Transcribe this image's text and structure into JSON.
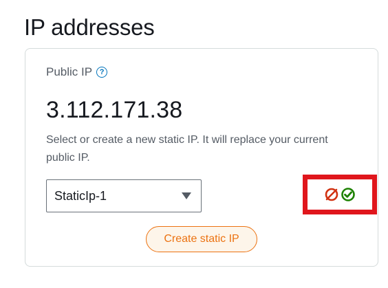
{
  "section": {
    "title": "IP addresses"
  },
  "card": {
    "label": "Public IP",
    "info_glyph": "?",
    "ip": "3.112.171.38",
    "description": "Select or create a new static IP. It will replace your current public IP.",
    "select": {
      "value": "StaticIp-1"
    },
    "create_button": "Create static IP"
  },
  "status_indicators": {
    "detach_icon": "no-symbol-icon",
    "attach_icon": "check-circle-icon",
    "colors": {
      "detach": "#d13212",
      "attach": "#1d8102",
      "highlight_border": "#e0161c",
      "accent": "#ec7211"
    }
  }
}
